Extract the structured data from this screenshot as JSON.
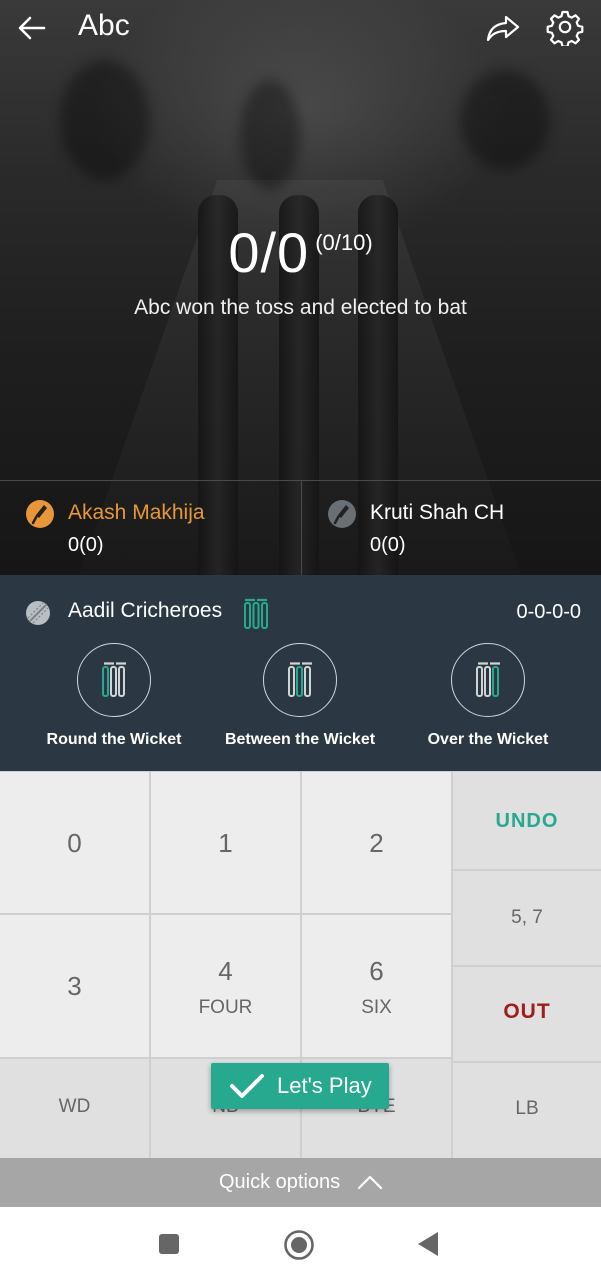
{
  "header": {
    "title": "Abc"
  },
  "score": {
    "runs_wickets": "0/0",
    "overs": "(0/10)",
    "status": "Abc won the toss and elected to bat"
  },
  "batters": [
    {
      "name": "Akash Makhija",
      "score": "0(0)",
      "on_strike": true,
      "color": "#e8963a"
    },
    {
      "name": "Kruti Shah CH",
      "score": "0(0)",
      "on_strike": false,
      "color": "#ffffff"
    }
  ],
  "bowler": {
    "name": "Aadil Cricheroes",
    "figures": "0-0-0-0"
  },
  "wicket_options": [
    {
      "label": "Round the Wicket",
      "icon": "stumps-round-icon"
    },
    {
      "label": "Between the Wicket",
      "icon": "stumps-between-icon"
    },
    {
      "label": "Over the Wicket",
      "icon": "stumps-over-icon"
    }
  ],
  "keypad": {
    "k0": "0",
    "k1": "1",
    "k2": "2",
    "k3": "3",
    "k4": "4",
    "k4_sub": "FOUR",
    "k6": "6",
    "k6_sub": "SIX",
    "wd": "WD",
    "nb": "NB",
    "bye": "BYE",
    "lb": "LB",
    "undo": "UNDO",
    "five_seven": "5, 7",
    "out": "OUT"
  },
  "lets_play": "Let's Play",
  "quick_options": "Quick options",
  "colors": {
    "accent": "#26a98e",
    "out": "#a11d1d",
    "panel": "#2b3843",
    "striker": "#e8963a"
  }
}
